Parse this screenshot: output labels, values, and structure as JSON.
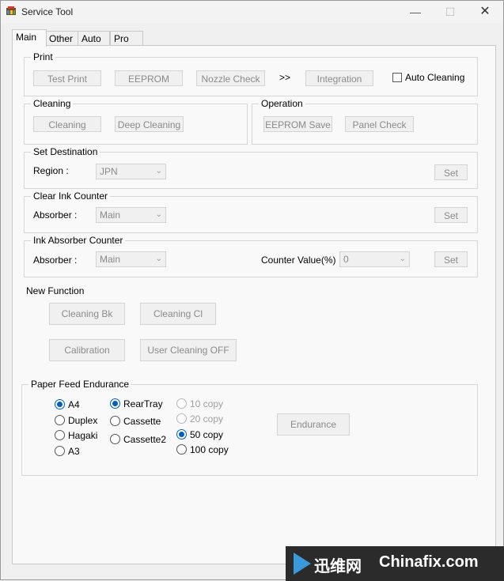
{
  "window": {
    "title": "Service Tool",
    "minimize": "—",
    "maximize": "☐",
    "close": "✕"
  },
  "tabs": [
    "Main",
    "Other",
    "Auto",
    "Pro"
  ],
  "print": {
    "legend": "Print",
    "test_print": "Test Print",
    "eeprom": "EEPROM",
    "nozzle_check": "Nozzle Check",
    "arrows": ">>",
    "integration": "Integration",
    "auto_cleaning": "Auto Cleaning"
  },
  "cleaning": {
    "legend": "Cleaning",
    "cleaning": "Cleaning",
    "deep_cleaning": "Deep Cleaning"
  },
  "operation": {
    "legend": "Operation",
    "eeprom_save": "EEPROM Save",
    "panel_check": "Panel Check"
  },
  "set_destination": {
    "legend": "Set Destination",
    "label": "Region :",
    "value": "JPN",
    "set": "Set"
  },
  "clear_ink_counter": {
    "legend": "Clear Ink Counter",
    "label": "Absorber :",
    "value": "Main",
    "set": "Set"
  },
  "ink_absorber_counter": {
    "legend": "Ink Absorber Counter",
    "label": "Absorber :",
    "value": "Main",
    "counter_label": "Counter Value(%) :",
    "counter_value": "0",
    "set": "Set"
  },
  "new_function": {
    "title": "New Function",
    "cleaning_bk": "Cleaning Bk",
    "cleaning_cl": "Cleaning Cl",
    "calibration": "Calibration",
    "user_cleaning_off": "User Cleaning OFF"
  },
  "paper_feed": {
    "legend": "Paper Feed Endurance",
    "sizes": [
      "A4",
      "Duplex",
      "Hagaki",
      "A3"
    ],
    "sources": [
      "RearTray",
      "Cassette",
      "Cassette2"
    ],
    "copies": [
      "10 copy",
      "20 copy",
      "50 copy",
      "100 copy"
    ],
    "endurance": "Endurance"
  },
  "watermark": {
    "cn": "迅维网",
    "en": "Chinafix.com"
  },
  "colors": {
    "accent": "#0060c0"
  }
}
